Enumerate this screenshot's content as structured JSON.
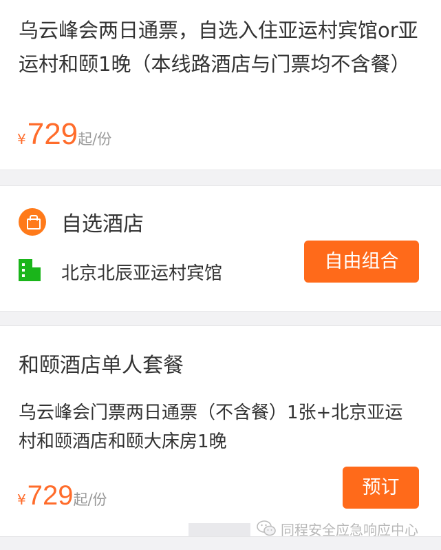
{
  "product": {
    "title": "乌云峰会两日通票，自选入住亚运村宾馆or亚运村和颐1晚（本线路酒店与门票均不含餐）",
    "price": {
      "currency": "¥",
      "amount": "729",
      "suffix": "起/份"
    }
  },
  "hotel_option": {
    "title": "自选酒店",
    "hotel_name": "北京北辰亚运村宾馆",
    "combo_button": "自由组合"
  },
  "package": {
    "title": "和颐酒店单人套餐",
    "description": "乌云峰会门票两日通票（不含餐）1张+北京亚运村和颐酒店和颐大床房1晚",
    "price": {
      "currency": "¥",
      "amount": "729",
      "suffix": "起/份"
    },
    "book_button": "预订"
  },
  "watermark": {
    "text": "同程安全应急响应中心"
  },
  "colors": {
    "accent": "#ff6a1a",
    "price": "#ff6c2b",
    "hotel_icon": "#1ab51a",
    "bag_icon": "#ff7a1a"
  },
  "icons": [
    "bag-icon",
    "building-icon",
    "wechat-icon"
  ]
}
